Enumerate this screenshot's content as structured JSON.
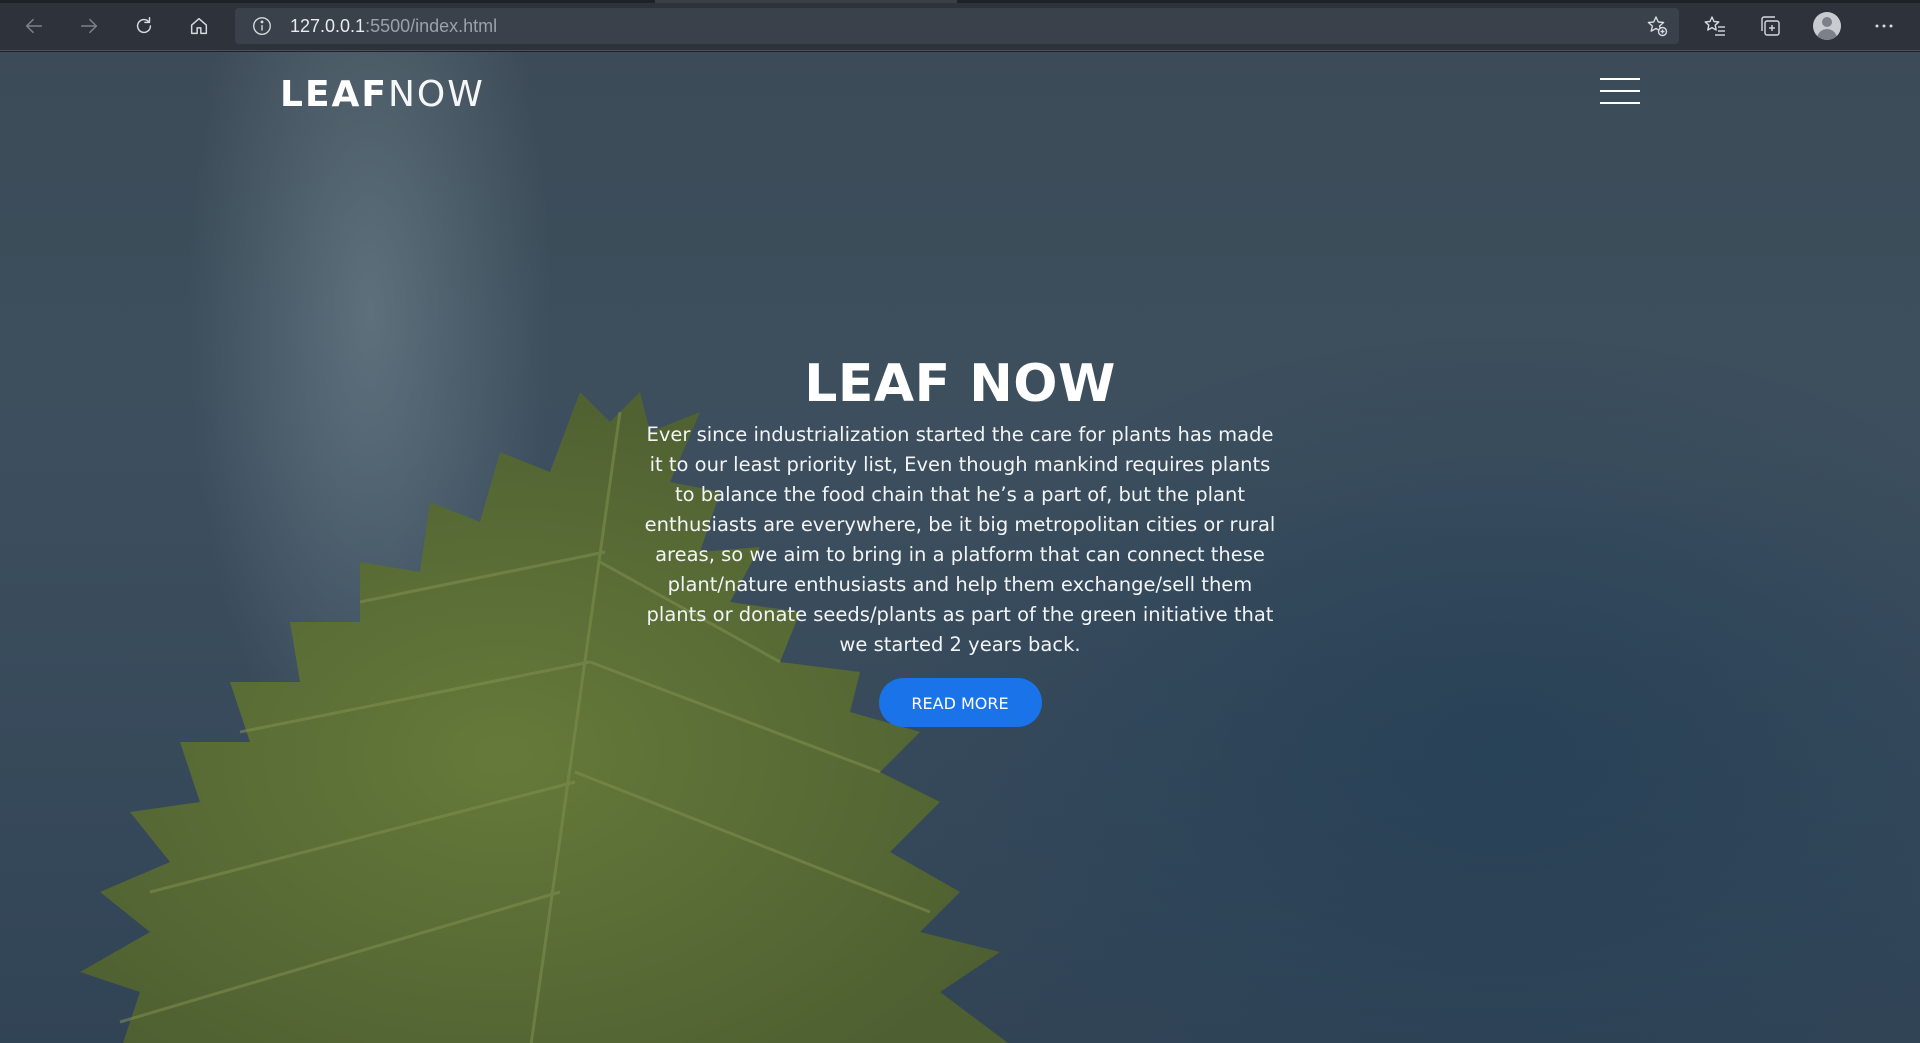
{
  "browser": {
    "url_host": "127.0.0.1",
    "url_rest": ":5500/index.html",
    "icons": {
      "back": "back-arrow-icon",
      "forward": "forward-arrow-icon",
      "refresh": "refresh-icon",
      "home": "home-icon",
      "site_info": "info-icon",
      "add_favorite": "star-plus-icon",
      "favorites": "favorites-icon",
      "collections": "collections-icon",
      "profile": "profile-icon",
      "more": "more-icon"
    }
  },
  "site": {
    "logo_bold": "LEAF",
    "logo_light": "NOW",
    "menu_icon": "hamburger-icon"
  },
  "hero": {
    "title": "LEAF NOW",
    "description": "Ever since industrialization started the care for plants has made it to our least priority list, Even though mankind requires plants to balance the food chain that he’s a part of, but the plant enthusiasts are everywhere, be it big metropolitan cities or rural areas, so we aim to bring in a platform that can connect these plant/nature enthusiasts and help them exchange/sell them plants or donate seeds/plants as part of the green initiative that we started 2 years back.",
    "button_label": "READ MORE"
  },
  "colors": {
    "button": "#1a73e8",
    "chrome_bg": "#2e333b",
    "address_bg": "#3b414b",
    "page_bg": "#3c4b57",
    "leaf": "#5e7136"
  }
}
